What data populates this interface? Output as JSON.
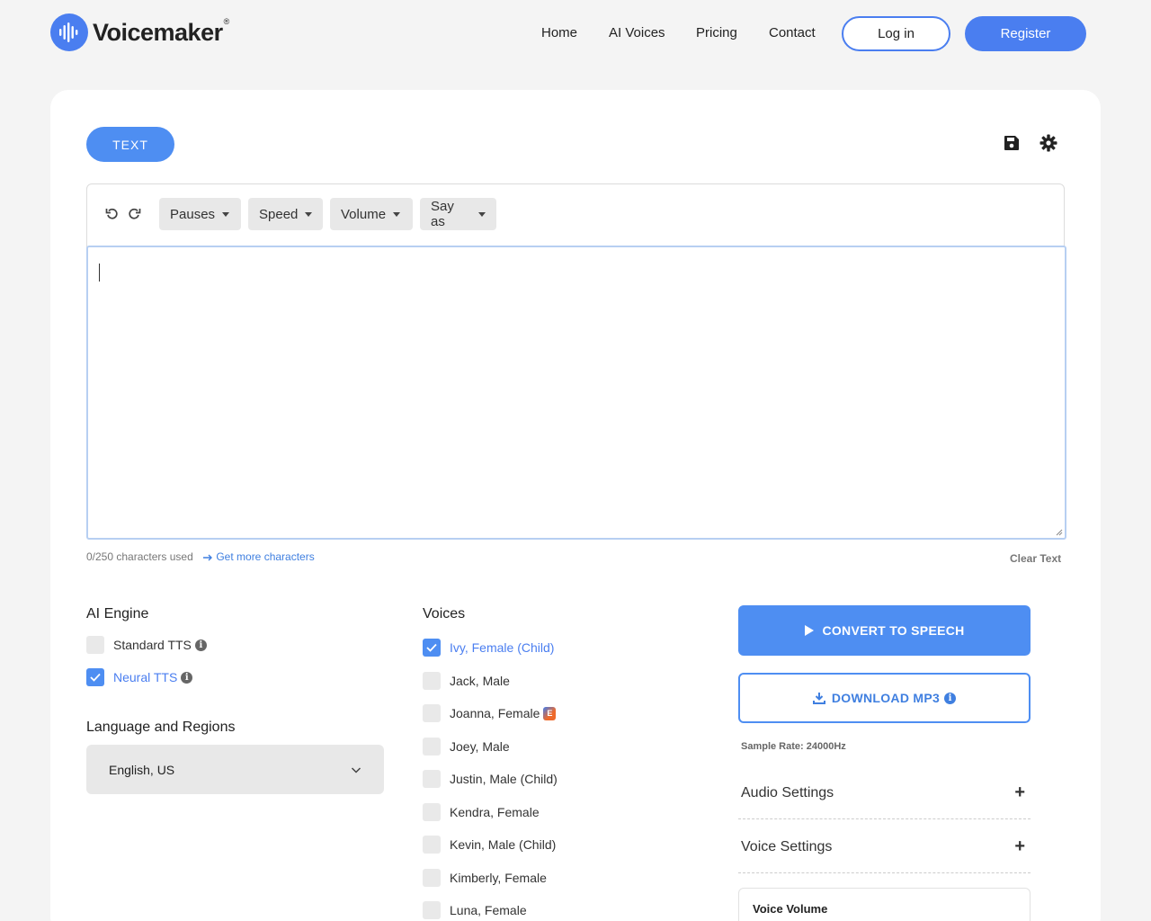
{
  "brand": {
    "name": "Voicemaker",
    "reg": "®"
  },
  "nav": {
    "home": "Home",
    "ai_voices": "AI Voices",
    "pricing": "Pricing",
    "contact": "Contact",
    "login": "Log in",
    "register": "Register"
  },
  "tabs": {
    "text": "TEXT"
  },
  "toolbar": {
    "pauses": "Pauses",
    "speed": "Speed",
    "volume": "Volume",
    "say_as": "Say as"
  },
  "editor": {
    "text": "",
    "char_used": "0/250 characters used",
    "more_chars": "Get more characters",
    "clear_text": "Clear Text"
  },
  "engine": {
    "title": "AI Engine",
    "options": [
      {
        "label": "Standard TTS",
        "checked": false
      },
      {
        "label": "Neural TTS",
        "checked": true
      }
    ]
  },
  "language": {
    "title": "Language and Regions",
    "selected": "English, US"
  },
  "voices": {
    "title": "Voices",
    "items": [
      {
        "label": "Ivy, Female (Child)",
        "checked": true
      },
      {
        "label": "Jack, Male",
        "checked": false
      },
      {
        "label": "Joanna, Female",
        "checked": false,
        "badge": "E"
      },
      {
        "label": "Joey, Male",
        "checked": false
      },
      {
        "label": "Justin, Male (Child)",
        "checked": false
      },
      {
        "label": "Kendra, Female",
        "checked": false
      },
      {
        "label": "Kevin, Male (Child)",
        "checked": false
      },
      {
        "label": "Kimberly, Female",
        "checked": false
      },
      {
        "label": "Luna, Female",
        "checked": false
      }
    ]
  },
  "actions": {
    "convert": "CONVERT TO SPEECH",
    "download": "DOWNLOAD MP3",
    "sample_rate": "Sample Rate: 24000Hz",
    "audio_settings": "Audio Settings",
    "voice_settings": "Voice Settings",
    "voice_volume": "Voice Volume"
  },
  "colors": {
    "accent": "#4e8ef2",
    "brand": "#4a7ef0"
  },
  "icons": [
    "voicemaker-logo-icon",
    "save-icon",
    "gear-icon",
    "undo-icon",
    "redo-icon",
    "play-icon",
    "download-icon",
    "info-icon",
    "chevron-down-icon",
    "plus-icon",
    "check-icon"
  ]
}
